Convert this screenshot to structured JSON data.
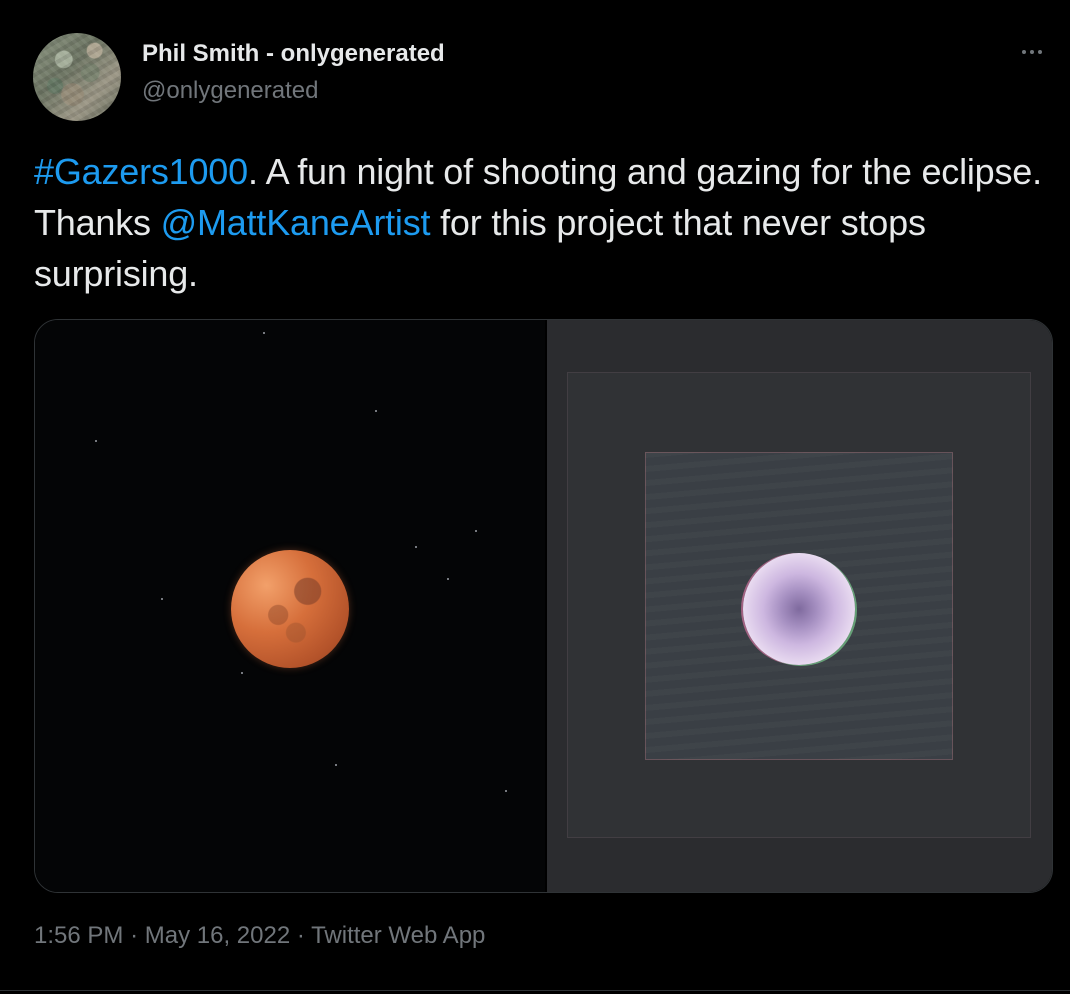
{
  "tweet": {
    "author": {
      "display_name": "Phil Smith - onlygenerated",
      "handle": "@onlygenerated"
    },
    "text": {
      "hashtag": "#Gazers1000",
      "part1": ". A fun night of shooting and gazing for the eclipse. Thanks ",
      "mention": "@MattKaneArtist",
      "part2": " for this project that never stops surprising."
    },
    "meta": {
      "time": "1:56 PM",
      "separator": "·",
      "date": "May 16, 2022",
      "source": "Twitter Web App"
    },
    "icons": {
      "more": "more-horizontal-icon"
    }
  },
  "colors": {
    "background": "#000000",
    "text_primary": "#e7e9ea",
    "text_secondary": "#71767b",
    "link": "#1d9bf0",
    "border": "#2f3336"
  }
}
